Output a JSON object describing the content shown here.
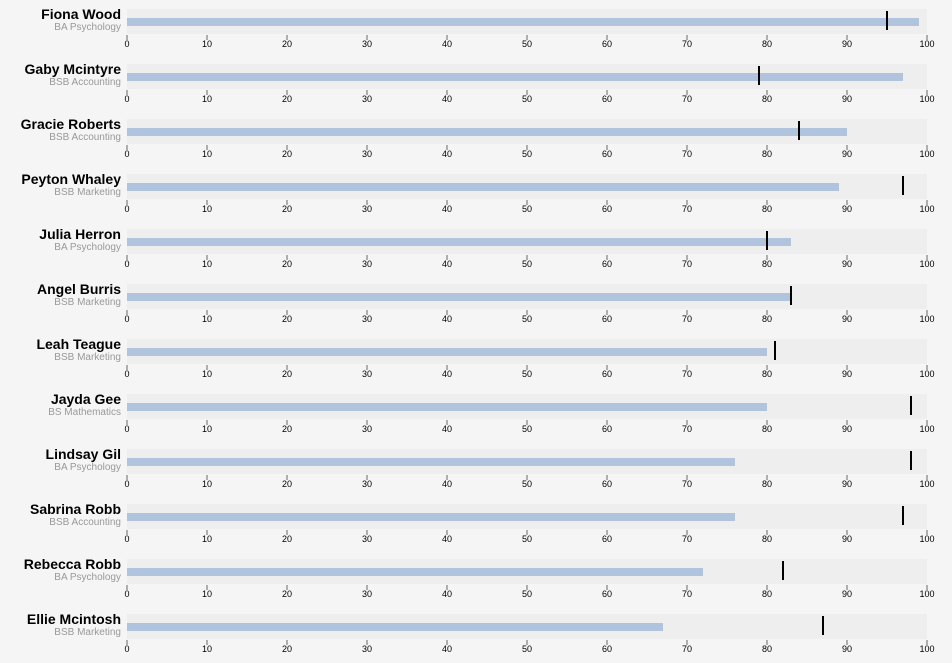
{
  "chart_data": {
    "type": "bullet",
    "xlim": [
      0,
      100
    ],
    "ticks": [
      0,
      10,
      20,
      30,
      40,
      50,
      60,
      70,
      80,
      90,
      100
    ],
    "range_max": 100,
    "grid": false,
    "colors": {
      "range": "#eeeeee",
      "measure": "#b0c4de",
      "marker": "#000000",
      "name": "#000000",
      "program": "#999999"
    },
    "rows": [
      {
        "name": "Fiona Wood",
        "program": "BA Psychology",
        "value": 99,
        "marker": 95
      },
      {
        "name": "Gaby Mcintyre",
        "program": "BSB Accounting",
        "value": 97,
        "marker": 79
      },
      {
        "name": "Gracie Roberts",
        "program": "BSB Accounting",
        "value": 90,
        "marker": 84
      },
      {
        "name": "Peyton Whaley",
        "program": "BSB Marketing",
        "value": 89,
        "marker": 97
      },
      {
        "name": "Julia Herron",
        "program": "BA Psychology",
        "value": 83,
        "marker": 80
      },
      {
        "name": "Angel Burris",
        "program": "BSB Marketing",
        "value": 83,
        "marker": 83
      },
      {
        "name": "Leah Teague",
        "program": "BSB Marketing",
        "value": 80,
        "marker": 81
      },
      {
        "name": "Jayda Gee",
        "program": "BS Mathematics",
        "value": 80,
        "marker": 98
      },
      {
        "name": "Lindsay Gil",
        "program": "BA Psychology",
        "value": 76,
        "marker": 98
      },
      {
        "name": "Sabrina Robb",
        "program": "BSB Accounting",
        "value": 76,
        "marker": 97
      },
      {
        "name": "Rebecca Robb",
        "program": "BA Psychology",
        "value": 72,
        "marker": 82
      },
      {
        "name": "Ellie Mcintosh",
        "program": "BSB Marketing",
        "value": 67,
        "marker": 87
      }
    ]
  }
}
